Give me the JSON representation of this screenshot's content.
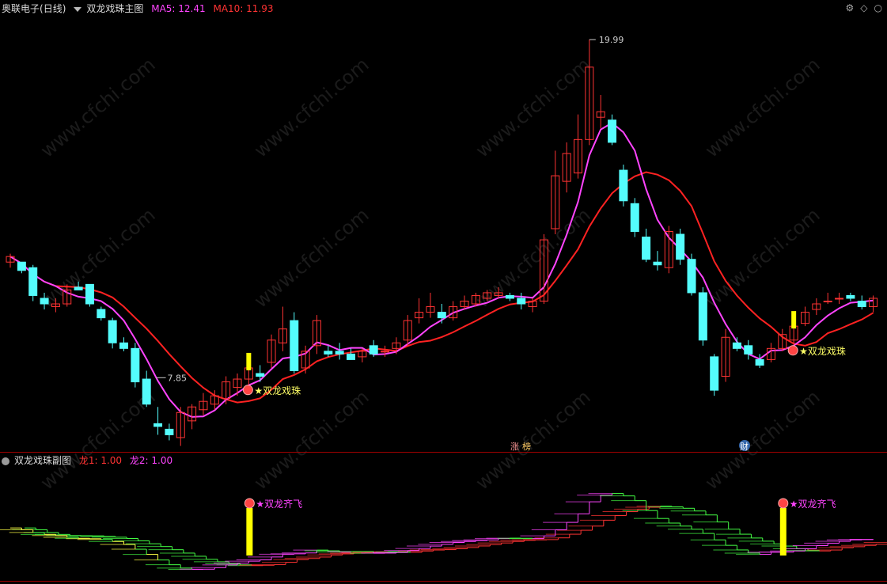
{
  "main": {
    "stock_name": "奥联电子",
    "period": "(日线)",
    "indicator": "双龙戏珠主图",
    "ma5_label": "MA5: 12.41",
    "ma10_label": "MA10: 11.93",
    "ma5_color": "#ff44ff",
    "ma10_color": "#ff2222",
    "high_label": "19.99",
    "low_label": "7.85",
    "signal_text": "★双龙戏珠",
    "badge1": "涨",
    "badge2": "榜",
    "badge3": "财",
    "corner_icons": [
      "gear-icon",
      "diamond-icon",
      "circle-icon"
    ]
  },
  "sub": {
    "indicator": "双龙戏珠副图",
    "dragon1_label": "龙1: 1.00",
    "dragon2_label": "龙2: 1.00",
    "dragon1_color": "#ff3333",
    "dragon2_color": "#ff44ff",
    "signal_text": "★双龙齐飞"
  },
  "watermark": "www.cfchi.com",
  "chart_data": {
    "type": "candlestick",
    "up_color": "#ff3333",
    "down_color": "#54fcfc",
    "price_range": [
      7.0,
      21.0
    ],
    "high": 19.99,
    "low": 7.85,
    "candles": [
      [
        12.0,
        12.3,
        11.8,
        12.2
      ],
      [
        12.0,
        12.0,
        11.6,
        11.7
      ],
      [
        11.8,
        11.9,
        10.6,
        10.8
      ],
      [
        10.7,
        10.9,
        10.3,
        10.5
      ],
      [
        10.4,
        10.7,
        10.2,
        10.5
      ],
      [
        10.5,
        11.2,
        10.4,
        11.0
      ],
      [
        11.1,
        11.3,
        11.0,
        11.0
      ],
      [
        11.2,
        11.2,
        10.4,
        10.5
      ],
      [
        10.3,
        10.4,
        9.9,
        10.0
      ],
      [
        9.9,
        10.0,
        8.9,
        9.1
      ],
      [
        9.1,
        9.3,
        8.8,
        8.9
      ],
      [
        8.9,
        9.1,
        7.5,
        7.7
      ],
      [
        7.8,
        8.1,
        6.8,
        6.9
      ],
      [
        6.2,
        6.8,
        5.8,
        6.1
      ],
      [
        6.0,
        6.2,
        5.6,
        5.8
      ],
      [
        5.7,
        6.8,
        5.4,
        6.6
      ],
      [
        6.3,
        6.9,
        6.0,
        6.8
      ],
      [
        6.7,
        7.3,
        6.5,
        7.0
      ],
      [
        6.9,
        7.4,
        6.7,
        7.2
      ],
      [
        7.1,
        7.9,
        6.9,
        7.7
      ],
      [
        7.5,
        8.0,
        7.2,
        7.8
      ],
      [
        7.8,
        8.4,
        7.6,
        8.2
      ],
      [
        8.0,
        8.3,
        7.7,
        7.9
      ],
      [
        8.4,
        9.4,
        8.2,
        9.2
      ],
      [
        9.1,
        10.4,
        8.8,
        9.6
      ],
      [
        9.9,
        10.2,
        8.0,
        8.1
      ],
      [
        8.2,
        9.0,
        8.0,
        8.8
      ],
      [
        9.0,
        10.1,
        8.7,
        9.9
      ],
      [
        8.8,
        9.0,
        8.6,
        8.7
      ],
      [
        8.8,
        9.1,
        8.5,
        8.7
      ],
      [
        8.7,
        8.9,
        8.5,
        8.5
      ],
      [
        8.6,
        8.9,
        8.4,
        8.8
      ],
      [
        9.0,
        9.2,
        8.6,
        8.7
      ],
      [
        8.8,
        9.0,
        8.6,
        8.8
      ],
      [
        8.9,
        9.3,
        8.7,
        9.1
      ],
      [
        9.2,
        10.1,
        9.0,
        9.9
      ],
      [
        10.0,
        10.7,
        9.8,
        10.2
      ],
      [
        10.2,
        10.9,
        10.0,
        10.4
      ],
      [
        10.2,
        10.5,
        9.8,
        10.0
      ],
      [
        10.0,
        10.6,
        9.9,
        10.4
      ],
      [
        10.4,
        10.8,
        10.3,
        10.6
      ],
      [
        10.5,
        10.9,
        10.4,
        10.8
      ],
      [
        10.7,
        11.0,
        10.6,
        10.9
      ],
      [
        10.8,
        11.1,
        10.7,
        10.9
      ],
      [
        10.8,
        10.9,
        10.6,
        10.7
      ],
      [
        10.7,
        10.9,
        10.3,
        10.5
      ],
      [
        10.4,
        10.7,
        10.2,
        10.6
      ],
      [
        10.6,
        13.0,
        10.5,
        12.8
      ],
      [
        13.2,
        16.0,
        13.0,
        15.1
      ],
      [
        14.9,
        16.3,
        14.5,
        15.9
      ],
      [
        15.2,
        17.3,
        15.0,
        16.4
      ],
      [
        16.4,
        19.99,
        16.2,
        19.0
      ],
      [
        17.2,
        18.0,
        16.8,
        17.4
      ],
      [
        17.1,
        17.3,
        16.2,
        16.3
      ],
      [
        15.3,
        15.5,
        14.0,
        14.2
      ],
      [
        14.1,
        14.3,
        12.9,
        13.1
      ],
      [
        12.9,
        13.2,
        12.0,
        12.1
      ],
      [
        12.0,
        12.4,
        11.7,
        11.9
      ],
      [
        11.8,
        13.3,
        11.6,
        13.1
      ],
      [
        13.0,
        13.2,
        11.9,
        12.1
      ],
      [
        12.1,
        12.3,
        10.8,
        10.9
      ],
      [
        10.9,
        11.1,
        9.0,
        9.2
      ],
      [
        8.6,
        8.7,
        7.2,
        7.4
      ],
      [
        7.9,
        9.6,
        7.7,
        9.3
      ],
      [
        9.1,
        9.3,
        8.8,
        8.9
      ],
      [
        9.0,
        9.2,
        8.5,
        8.7
      ],
      [
        8.5,
        8.7,
        8.2,
        8.3
      ],
      [
        8.5,
        9.1,
        8.4,
        8.9
      ],
      [
        8.9,
        9.6,
        8.8,
        9.4
      ],
      [
        9.2,
        9.9,
        9.0,
        9.7
      ],
      [
        9.8,
        10.4,
        9.7,
        10.2
      ],
      [
        10.3,
        10.7,
        10.1,
        10.5
      ],
      [
        10.6,
        10.9,
        10.5,
        10.6
      ],
      [
        10.7,
        10.9,
        10.5,
        10.7
      ],
      [
        10.8,
        10.9,
        10.6,
        10.7
      ],
      [
        10.6,
        10.8,
        10.3,
        10.4
      ],
      [
        10.4,
        10.8,
        10.2,
        10.7
      ]
    ]
  }
}
